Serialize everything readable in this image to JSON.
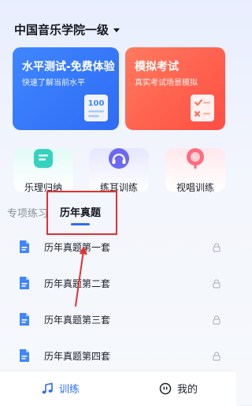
{
  "header": {
    "title": "中国音乐学院一级"
  },
  "cards": [
    {
      "title": "水平测试-免费体验",
      "subtitle": "快速了解当前水平",
      "icon": "score-100-icon",
      "color": "#3f86ff"
    },
    {
      "title": "模拟考试",
      "subtitle": "真实考试场景模拟",
      "icon": "exam-paper-icon",
      "color": "#ff5a4a"
    }
  ],
  "quick": [
    {
      "label": "乐理归纳",
      "icon": "book-icon"
    },
    {
      "label": "练耳训练",
      "icon": "headphones-icon"
    },
    {
      "label": "视唱训练",
      "icon": "microphone-icon"
    }
  ],
  "tabs": {
    "inactive": "专项练习",
    "active": "历年真题"
  },
  "papers": [
    {
      "name": "历年真题第一套",
      "locked": true
    },
    {
      "name": "历年真题第二套",
      "locked": true
    },
    {
      "name": "历年真题第三套",
      "locked": true
    },
    {
      "name": "历年真题第四套",
      "locked": true
    }
  ],
  "bottom_nav": {
    "train": "训练",
    "me": "我的"
  },
  "colors": {
    "accent": "#2f6cf5",
    "annotation": "#e43030"
  }
}
